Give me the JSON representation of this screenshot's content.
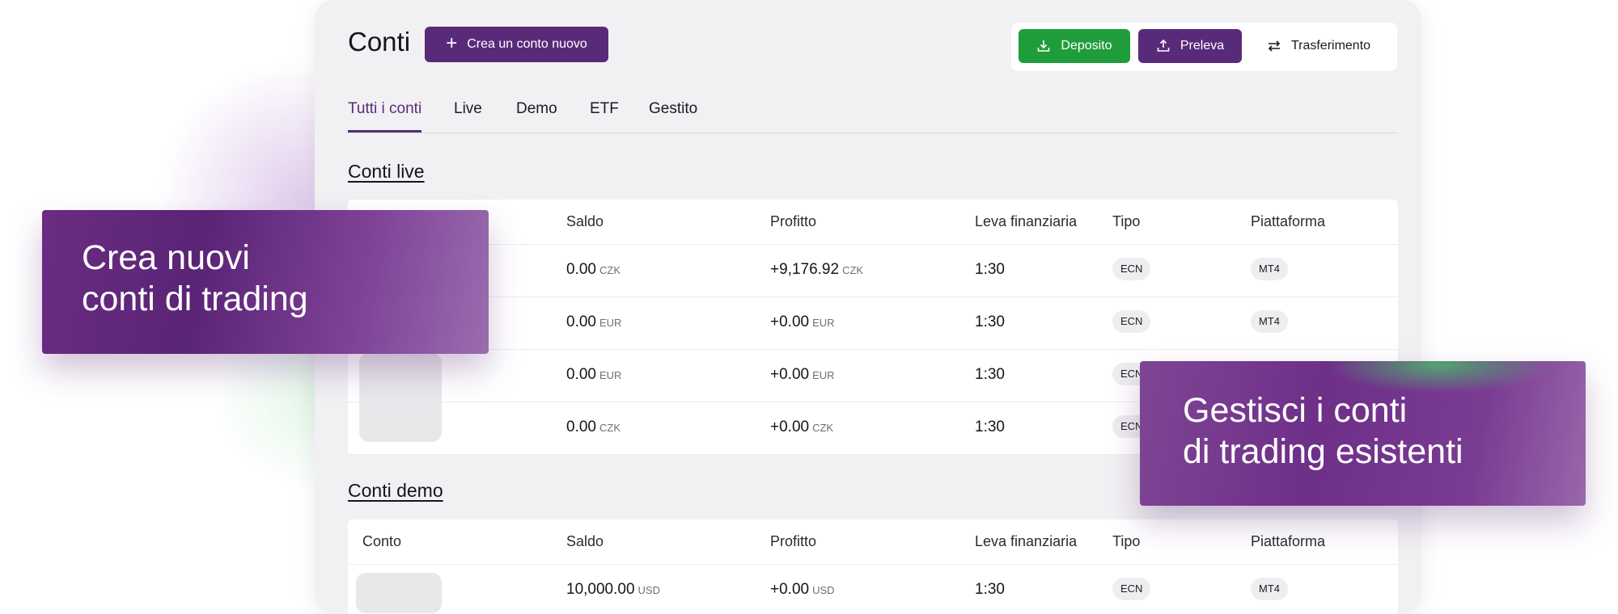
{
  "header": {
    "title": "Conti",
    "create_label": "Crea un conto nuovo",
    "deposit_label": "Deposito",
    "withdraw_label": "Preleva",
    "transfer_label": "Trasferimento"
  },
  "tabs": [
    "Tutti i conti",
    "Live",
    "Demo",
    "ETF",
    "Gestito"
  ],
  "live": {
    "title": "Conti live",
    "columns": {
      "saldo": "Saldo",
      "profitto": "Profitto",
      "leva": "Leva finanziaria",
      "tipo": "Tipo",
      "piattaforma": "Piattaforma"
    },
    "rows": [
      {
        "saldo": "0.00",
        "saldo_cur": "CZK",
        "profitto": "+9,176.92",
        "profitto_cur": "CZK",
        "leva": "1:30",
        "tipo": "ECN",
        "piattaforma": "MT4"
      },
      {
        "saldo": "0.00",
        "saldo_cur": "EUR",
        "profitto": "+0.00",
        "profitto_cur": "EUR",
        "leva": "1:30",
        "tipo": "ECN",
        "piattaforma": "MT4"
      },
      {
        "saldo": "0.00",
        "saldo_cur": "EUR",
        "profitto": "+0.00",
        "profitto_cur": "EUR",
        "leva": "1:30",
        "tipo": "ECN",
        "piattaforma": ""
      },
      {
        "saldo": "0.00",
        "saldo_cur": "CZK",
        "profitto": "+0.00",
        "profitto_cur": "CZK",
        "leva": "1:30",
        "tipo": "ECN",
        "piattaforma": ""
      }
    ]
  },
  "demo": {
    "title": "Conti demo",
    "columns": {
      "conto": "Conto",
      "saldo": "Saldo",
      "profitto": "Profitto",
      "leva": "Leva finanziaria",
      "tipo": "Tipo",
      "piattaforma": "Piattaforma"
    },
    "rows": [
      {
        "saldo": "10,000.00",
        "saldo_cur": "USD",
        "profitto": "+0.00",
        "profitto_cur": "USD",
        "leva": "1:30",
        "tipo": "ECN",
        "piattaforma": "MT4"
      }
    ]
  },
  "callouts": {
    "left_line1": "Crea nuovi",
    "left_line2": "conti di trading",
    "right_line1": "Gestisci i conti",
    "right_line2": "di trading esistenti"
  }
}
